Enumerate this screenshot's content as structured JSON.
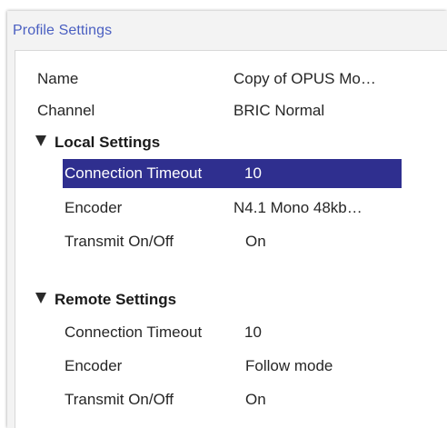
{
  "window": {
    "title": "Profile Settings"
  },
  "profile": {
    "name_label": "Name",
    "name_value": "Copy of OPUS Mo…",
    "channel_label": "Channel",
    "channel_value": "BRIC Normal"
  },
  "local": {
    "header": "Local Settings",
    "connection_timeout_label": "Connection Timeout",
    "connection_timeout_value": "10",
    "encoder_label": "Encoder",
    "encoder_value": "N4.1 Mono 48kb…",
    "transmit_label": "Transmit On/Off",
    "transmit_value": "On"
  },
  "remote": {
    "header": "Remote Settings",
    "connection_timeout_label": "Connection Timeout",
    "connection_timeout_value": "10",
    "encoder_label": "Encoder",
    "encoder_value": "Follow mode",
    "transmit_label": "Transmit On/Off",
    "transmit_value": "On"
  },
  "colors": {
    "title": "#4a5fc1",
    "selection": "#2f2f8f"
  },
  "icons": {
    "expanded": "triangle-down-icon"
  }
}
